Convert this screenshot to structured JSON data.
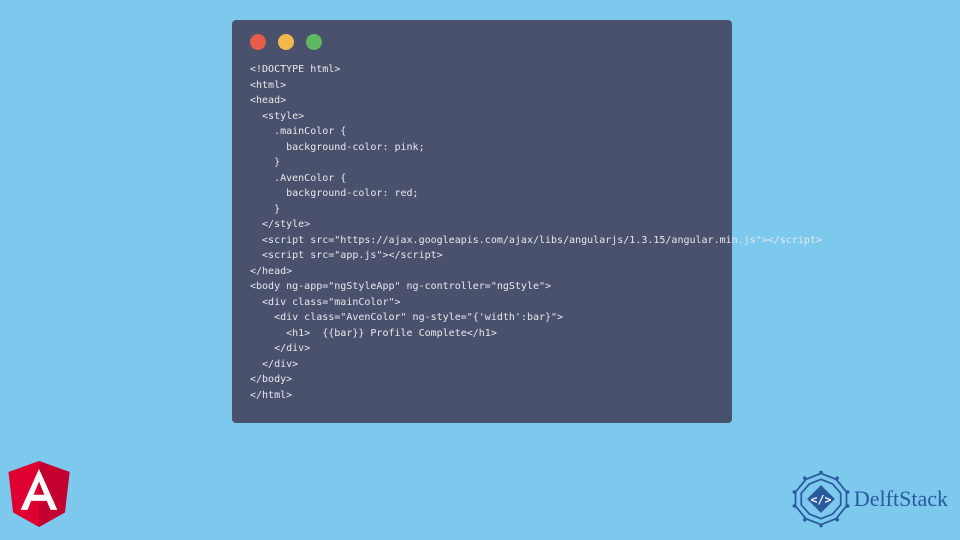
{
  "window": {
    "controls": {
      "red": "close",
      "yellow": "minimize",
      "green": "maximize"
    }
  },
  "code": {
    "lines": [
      "<!DOCTYPE html>",
      "<html>",
      "<head>",
      "  <style>",
      "    .mainColor {",
      "      background-color: pink;",
      "    }",
      "    .AvenColor {",
      "      background-color: red;",
      "    }",
      "  </style>",
      "  <script src=\"https://ajax.googleapis.com/ajax/libs/angularjs/1.3.15/angular.min.js\"></script>",
      "  <script src=\"app.js\"></script>",
      "</head>",
      "<body ng-app=\"ngStyleApp\" ng-controller=\"ngStyle\">",
      "  <div class=\"mainColor\">",
      "    <div class=\"AvenColor\" ng-style=\"{'width':bar}\">",
      "      <h1>  {{bar}} Profile Complete</h1>",
      "    </div>",
      "  </div>",
      "</body>",
      "</html>"
    ]
  },
  "logos": {
    "angular": "Angular",
    "delftstack": "DelftStack"
  }
}
